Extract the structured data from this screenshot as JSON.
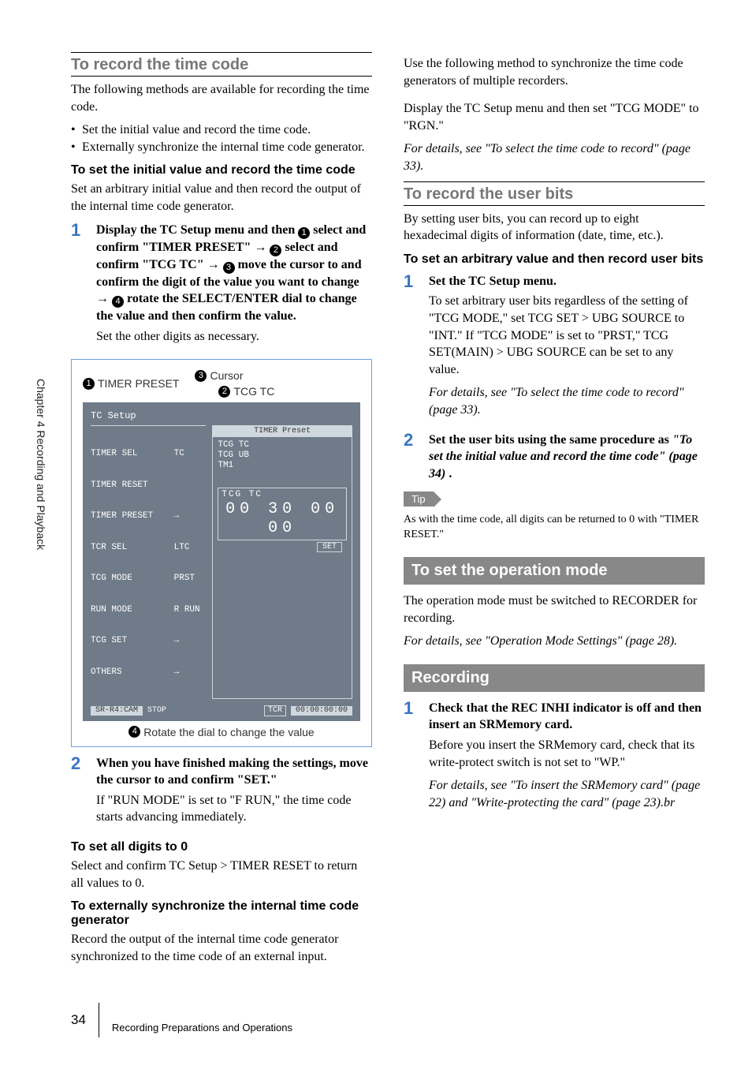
{
  "side_label": "Chapter 4  Recording and Playback",
  "left": {
    "section_title": "To record the time code",
    "intro": "The following methods are available for recording the time code.",
    "bullets": [
      "Set the initial value and record the time code.",
      "Externally synchronize the internal time code generator."
    ],
    "sub1_title": "To set the initial value and record the time code",
    "sub1_body": "Set an arbitrary initial value and then record the output of the internal time code generator.",
    "step1": {
      "num": "1",
      "head_parts": {
        "p1": "Display the TC Setup menu and then ",
        "p2": " select and confirm \"TIMER PRESET\" ",
        "arrow1": "→",
        "p3": " select and confirm \"TCG TC\" ",
        "arrow2": "→",
        "p4": " move the cursor to and confirm the digit of the value you want to change ",
        "arrow3": "→",
        "p5": " rotate the SELECT/ENTER dial to change the value and then confirm the value."
      },
      "body": "Set the other digits as necessary."
    },
    "figure": {
      "lbl1": "TIMER PRESET",
      "lbl2": "Cursor",
      "lbl3": "TCG TC",
      "screen_title": "TC Setup",
      "menu_lines": [
        "TIMER SEL       TC",
        "TIMER RESET",
        "TIMER PRESET    →",
        "TCR SEL         LTC",
        "TCG MODE        PRST",
        "RUN MODE        R RUN",
        "TCG SET         →",
        "OTHERS          →"
      ],
      "popup_title": "TIMER Preset",
      "popup_lines": [
        "TCG TC",
        "TCG UB",
        "TM1"
      ],
      "tcg_label": "TCG TC",
      "tcg_value": "00 30 00 00",
      "set_btn": "SET",
      "status_left": "SR-R4:CAM",
      "status_stop": "STOP",
      "status_tcr": "TCR",
      "status_tc": "00:00:00:00",
      "foot": "Rotate the dial to change the value"
    },
    "step2": {
      "num": "2",
      "head": "When you have finished making the settings, move the cursor to and confirm \"SET.\"",
      "body": "If \"RUN MODE\" is set to \"F RUN,\" the time code starts advancing immediately."
    },
    "sub2_title": "To set all digits to 0",
    "sub2_body": "Select and confirm TC Setup > TIMER RESET to return all values to 0.",
    "sub3_title": "To externally synchronize the internal time code generator",
    "sub3_body": "Record the output of the internal time code generator synchronized to the time code of an external input."
  },
  "right": {
    "sync_intro": "Use the following method to synchronize the time code generators of multiple recorders.",
    "sync_body": "Display the TC Setup menu and then set \"TCG MODE\" to \"RGN.\"",
    "sync_ref": "For details, see \"To select the time code to record\" (page 33).",
    "userbits_title": "To record the user bits",
    "userbits_intro": "By setting user bits, you can record up to eight hexadecimal digits of information (date, time, etc.).",
    "ub_sub_title": "To set an arbitrary value and then record user bits",
    "ub_step1": {
      "num": "1",
      "head": "Set the TC Setup menu.",
      "body": "To set arbitrary user bits regardless of the setting of \"TCG MODE,\" set TCG SET > UBG SOURCE to \"INT.\" If \"TCG MODE\" is set to \"PRST,\" TCG SET(MAIN) > UBG SOURCE can be set to any value.",
      "ref": "For details, see \"To select the time code to record\" (page 33)."
    },
    "ub_step2": {
      "num": "2",
      "head_prefix": "Set the user bits using the same procedure as ",
      "head_ref": "\"To set the initial value and record the time code\" (page 34)",
      "head_suffix": "."
    },
    "tip_label": "Tip",
    "tip_body": "As with the time code, all digits can be returned to 0 with \"TIMER RESET.\"",
    "op_mode_bar": "To set the operation mode",
    "op_mode_body": "The operation mode must be switched to RECORDER for recording.",
    "op_mode_ref": "For details, see \"Operation Mode Settings\" (page 28).",
    "recording_bar": "Recording",
    "rec_step1": {
      "num": "1",
      "head": "Check that the REC INHI indicator is off and then insert an SRMemory card.",
      "body": "Before you insert the SRMemory card, check that its write-protect switch is not set to \"WP.\"",
      "ref": "For details, see \"To insert the SRMemory card\" (page 22) and \"Write-protecting the card\" (page 23).br"
    }
  },
  "footer": {
    "page_num": "34",
    "text": "Recording Preparations and Operations"
  }
}
